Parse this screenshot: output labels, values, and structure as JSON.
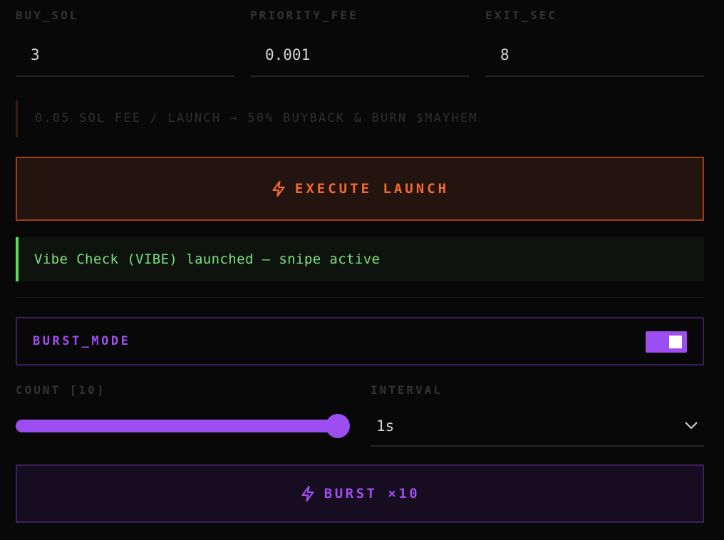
{
  "fields": [
    {
      "label": "BUY_SOL",
      "value": "3"
    },
    {
      "label": "PRIORITY_FEE",
      "value": "0.001"
    },
    {
      "label": "EXIT_SEC",
      "value": "8"
    }
  ],
  "fee_notice": "0.05 SOL FEE / LAUNCH → 50% BUYBACK & BURN $MAYHEM",
  "execute": {
    "label": "EXECUTE LAUNCH",
    "icon": "lightning-icon",
    "color": "#f26a33"
  },
  "status": {
    "message": "Vibe Check (VIBE) launched — snipe active",
    "color": "#7ee081"
  },
  "burst_mode": {
    "label": "BURST_MODE",
    "enabled": true,
    "accent": "#9d4ef0"
  },
  "count": {
    "label": "COUNT [10]",
    "value": 10,
    "min": 1,
    "max": 10
  },
  "interval": {
    "label": "INTERVAL",
    "selected": "1s",
    "icon": "chevron-down-icon"
  },
  "burst_button": {
    "label": "BURST ×10",
    "icon": "lightning-icon"
  }
}
